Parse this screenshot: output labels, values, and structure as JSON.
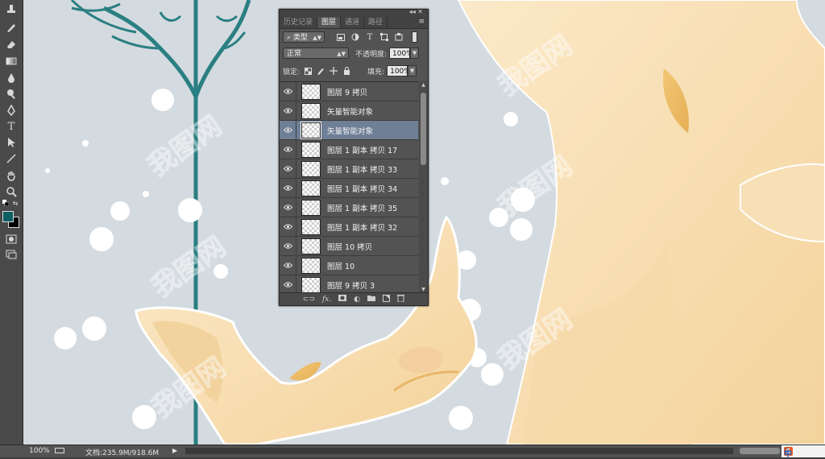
{
  "toolbar": {
    "tools": [
      "stamp-tool",
      "history-brush-tool",
      "eraser-tool",
      "gradient-tool",
      "blur-tool",
      "dodge-tool",
      "pen-tool",
      "type-tool",
      "path-selection-tool",
      "line-tool",
      "hand-tool",
      "zoom-tool",
      "quick-mask-tool",
      "screen-mode-tool"
    ],
    "type_tool_glyph": "T",
    "foreground_color": "#0d5f63",
    "background_color": "#000000"
  },
  "layers_panel": {
    "tabs": [
      "历史记录",
      "图层",
      "通道",
      "路径"
    ],
    "active_tab": "图层",
    "filter_kind": "类型",
    "blend_mode": "正常",
    "opacity_label": "不透明度:",
    "opacity_value": "100%",
    "lock_label": "锁定:",
    "fill_label": "填充:",
    "fill_value": "100%",
    "layers": [
      {
        "name": "图层 9 拷贝",
        "selected": false
      },
      {
        "name": "矢量智能对象",
        "selected": false
      },
      {
        "name": "矢量智能对象",
        "selected": true
      },
      {
        "name": "图层 1 副本 拷贝 17",
        "selected": false
      },
      {
        "name": "图层 1 副本 拷贝 33",
        "selected": false
      },
      {
        "name": "图层 1 副本 拷贝 34",
        "selected": false
      },
      {
        "name": "图层 1 副本 拷贝 35",
        "selected": false
      },
      {
        "name": "图层 1 副本 拷贝 32",
        "selected": false
      },
      {
        "name": "图层 10 拷贝",
        "selected": false
      },
      {
        "name": "图层 10",
        "selected": false
      },
      {
        "name": "图层 9 拷贝 3",
        "selected": false
      }
    ],
    "footer_fx": "fx."
  },
  "statusbar": {
    "zoom": "100%",
    "doc_info": "文档:235.9M/918.6M"
  },
  "ime": {
    "logo_char": "S",
    "lang": "中"
  },
  "colors": {
    "canvas_bg": "#d4dbe0",
    "tree": "#2a7f82",
    "deer": "#f7dfb6",
    "deer_dark": "#efc883",
    "selected_layer": "#6e7f96"
  }
}
